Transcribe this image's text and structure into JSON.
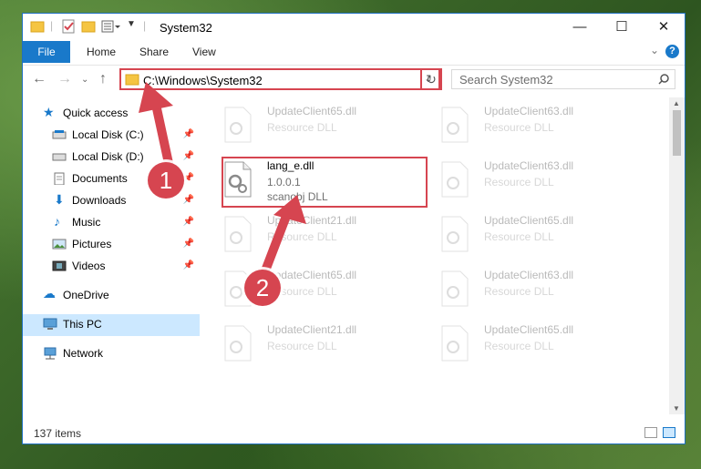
{
  "window": {
    "title": "System32"
  },
  "controls": {
    "minimize": "—",
    "maximize": "☐",
    "close": "✕"
  },
  "ribbon": {
    "file": "File",
    "home": "Home",
    "share": "Share",
    "view": "View",
    "help": "?"
  },
  "address": {
    "path": "C:\\Windows\\System32"
  },
  "search": {
    "placeholder": "Search System32"
  },
  "sidebar": {
    "quick_access": "Quick access",
    "items": [
      {
        "label": "Local Disk (C:)",
        "icon": "drive-icon"
      },
      {
        "label": "Local Disk (D:)",
        "icon": "drive-icon"
      },
      {
        "label": "Documents",
        "icon": "documents-icon"
      },
      {
        "label": "Downloads",
        "icon": "downloads-icon"
      },
      {
        "label": "Music",
        "icon": "music-icon"
      },
      {
        "label": "Pictures",
        "icon": "pictures-icon"
      },
      {
        "label": "Videos",
        "icon": "videos-icon"
      }
    ],
    "onedrive": "OneDrive",
    "this_pc": "This PC",
    "network": "Network"
  },
  "files": [
    {
      "name": "UpdateClient65.dll",
      "type": "Resource DLL"
    },
    {
      "name": "UpdateClient63.dll",
      "type": "Resource DLL"
    },
    {
      "name": "lang_e.dll",
      "version": "1.0.0.1",
      "type": "scanobj DLL"
    },
    {
      "name": "UpdateClient63.dll",
      "type": "Resource DLL"
    },
    {
      "name": "UpdateClient21.dll",
      "type": "Resource DLL"
    },
    {
      "name": "UpdateClient65.dll",
      "type": "Resource DLL"
    },
    {
      "name": "UpdateClient65.dll",
      "type": "Resource DLL"
    },
    {
      "name": "UpdateClient63.dll",
      "type": "Resource DLL"
    },
    {
      "name": "UpdateClient21.dll",
      "type": "Resource DLL"
    },
    {
      "name": "UpdateClient65.dll",
      "type": "Resource DLL"
    }
  ],
  "status": {
    "count": "137 items"
  },
  "callouts": {
    "one": "1",
    "two": "2"
  },
  "colors": {
    "accent": "#1979ca",
    "highlight": "#d64550",
    "selected": "#cce8ff"
  }
}
